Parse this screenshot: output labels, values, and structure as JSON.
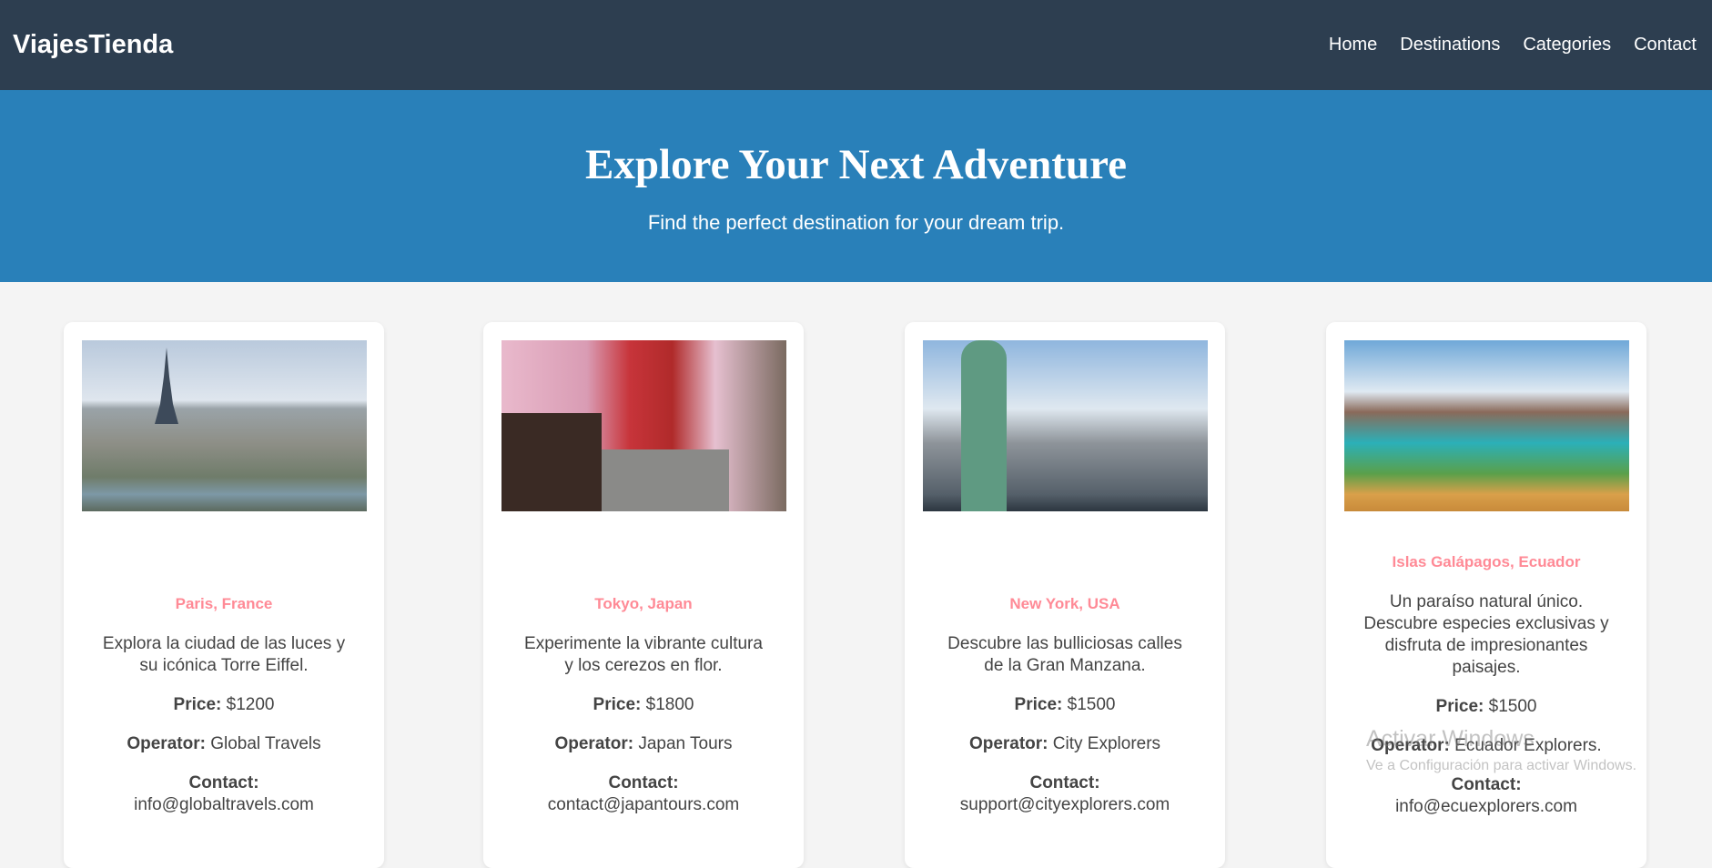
{
  "nav": {
    "logo": "ViajesTienda",
    "links": [
      "Home",
      "Destinations",
      "Categories",
      "Contact"
    ]
  },
  "hero": {
    "title": "Explore Your Next Adventure",
    "subtitle": "Find the perfect destination for your dream trip."
  },
  "labels": {
    "price": "Price:",
    "operator": "Operator:",
    "contact": "Contact:"
  },
  "cards": [
    {
      "name": "Paris, France",
      "desc": "Explora la ciudad de las luces y su icónica Torre Eiffel.",
      "price": "$1200",
      "operator": "Global Travels",
      "contact": "info@globaltravels.com"
    },
    {
      "name": "Tokyo, Japan",
      "desc": "Experimente la vibrante cultura y los cerezos en flor.",
      "price": "$1800",
      "operator": "Japan Tours",
      "contact": "contact@japantours.com"
    },
    {
      "name": "New York, USA",
      "desc": "Descubre las bulliciosas calles de la Gran Manzana.",
      "price": "$1500",
      "operator": "City Explorers",
      "contact": "support@cityexplorers.com"
    },
    {
      "name": "Islas Galápagos, Ecuador",
      "desc": "Un paraíso natural único. Descubre especies exclusivas y disfruta de impresionantes paisajes.",
      "price": "$1500",
      "operator": "Ecuador Explorers.",
      "contact": "info@ecuexplorers.com"
    }
  ],
  "watermark": {
    "title": "Activar Windows",
    "subtitle": "Ve a Configuración para activar Windows."
  }
}
